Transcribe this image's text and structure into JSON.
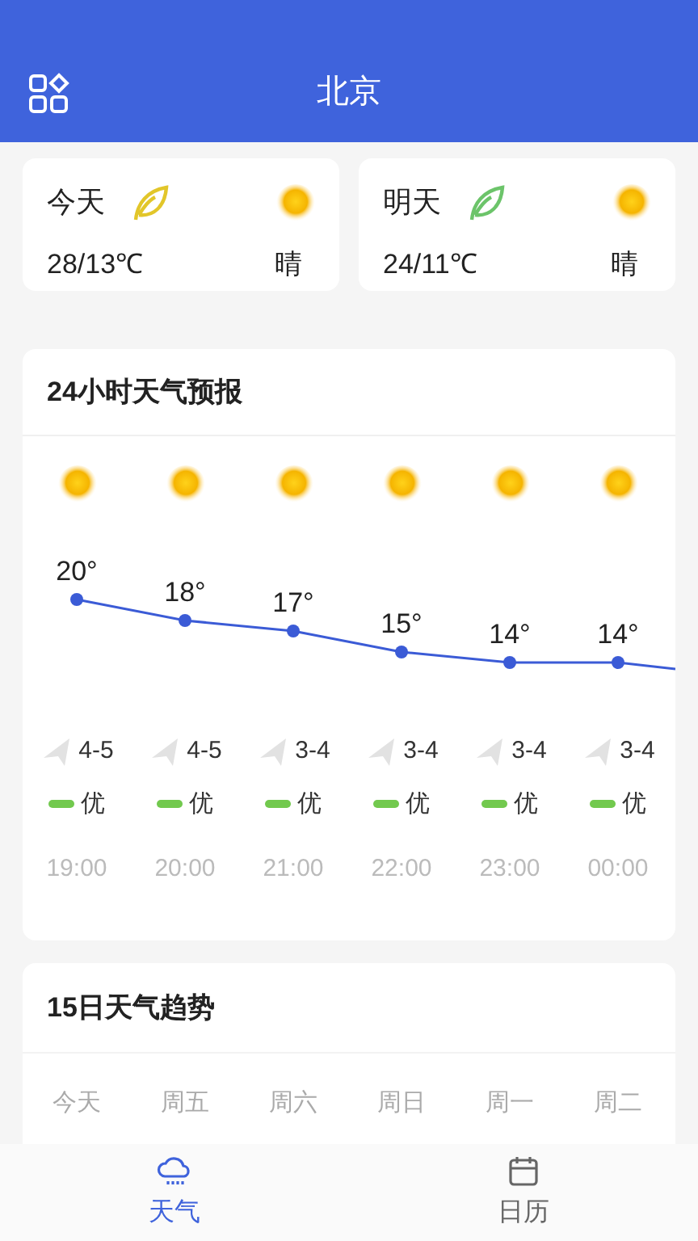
{
  "header": {
    "title": "北京"
  },
  "day_cards": [
    {
      "label": "今天",
      "color": "#e2c62a",
      "temp": "28/13℃",
      "condition": "晴"
    },
    {
      "label": "明天",
      "color": "#6cc46a",
      "temp": "24/11℃",
      "condition": "晴"
    }
  ],
  "hourly": {
    "title": "24小时天气预报",
    "hours": [
      {
        "wind": "4-5",
        "aqi": "优"
      },
      {
        "wind": "4-5",
        "aqi": "优"
      },
      {
        "wind": "3-4",
        "aqi": "优"
      },
      {
        "wind": "3-4",
        "aqi": "优"
      },
      {
        "wind": "3-4",
        "aqi": "优"
      },
      {
        "wind": "3-4",
        "aqi": "优"
      }
    ],
    "chart_data": {
      "type": "line",
      "categories": [
        "19:00",
        "20:00",
        "21:00",
        "22:00",
        "23:00",
        "00:00"
      ],
      "series": [
        {
          "color": "#3b5bd6",
          "marker": "circle",
          "values": [
            20,
            18,
            17,
            15,
            14,
            14
          ],
          "value_labels": [
            "20°",
            "18°",
            "17°",
            "15°",
            "14°",
            "14°"
          ]
        }
      ]
    }
  },
  "trend": {
    "title": "15日天气趋势",
    "days": [
      "今天",
      "周五",
      "周六",
      "周日",
      "周一",
      "周二"
    ]
  },
  "nav": [
    {
      "kind": "weather",
      "label": "天气",
      "selected": true
    },
    {
      "kind": "calendar",
      "label": "日历",
      "selected": false
    }
  ]
}
